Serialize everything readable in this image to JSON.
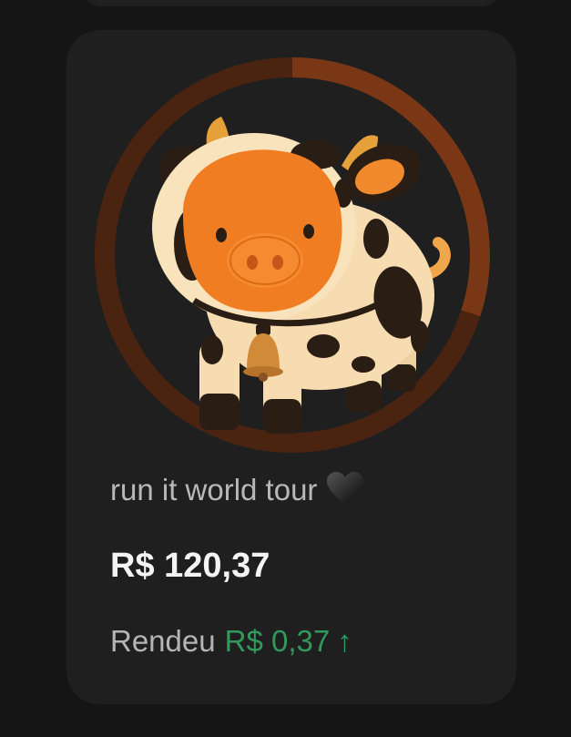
{
  "card": {
    "title": "run it world tour",
    "title_emoji_icon": "black-heart-icon",
    "amount": "R$ 120,37",
    "yield_label": "Rendeu",
    "yield_value": "R$ 0,37",
    "yield_arrow": "↑",
    "image_icon": "cow-costume-piggy-bank-icon"
  },
  "progress_ring": {
    "progress": 0.3,
    "track_color": "#4a2410",
    "fill_color": "#7a3715"
  },
  "colors": {
    "background": "#151515",
    "card": "#1f1f1f",
    "positive": "#2f9a5b"
  }
}
